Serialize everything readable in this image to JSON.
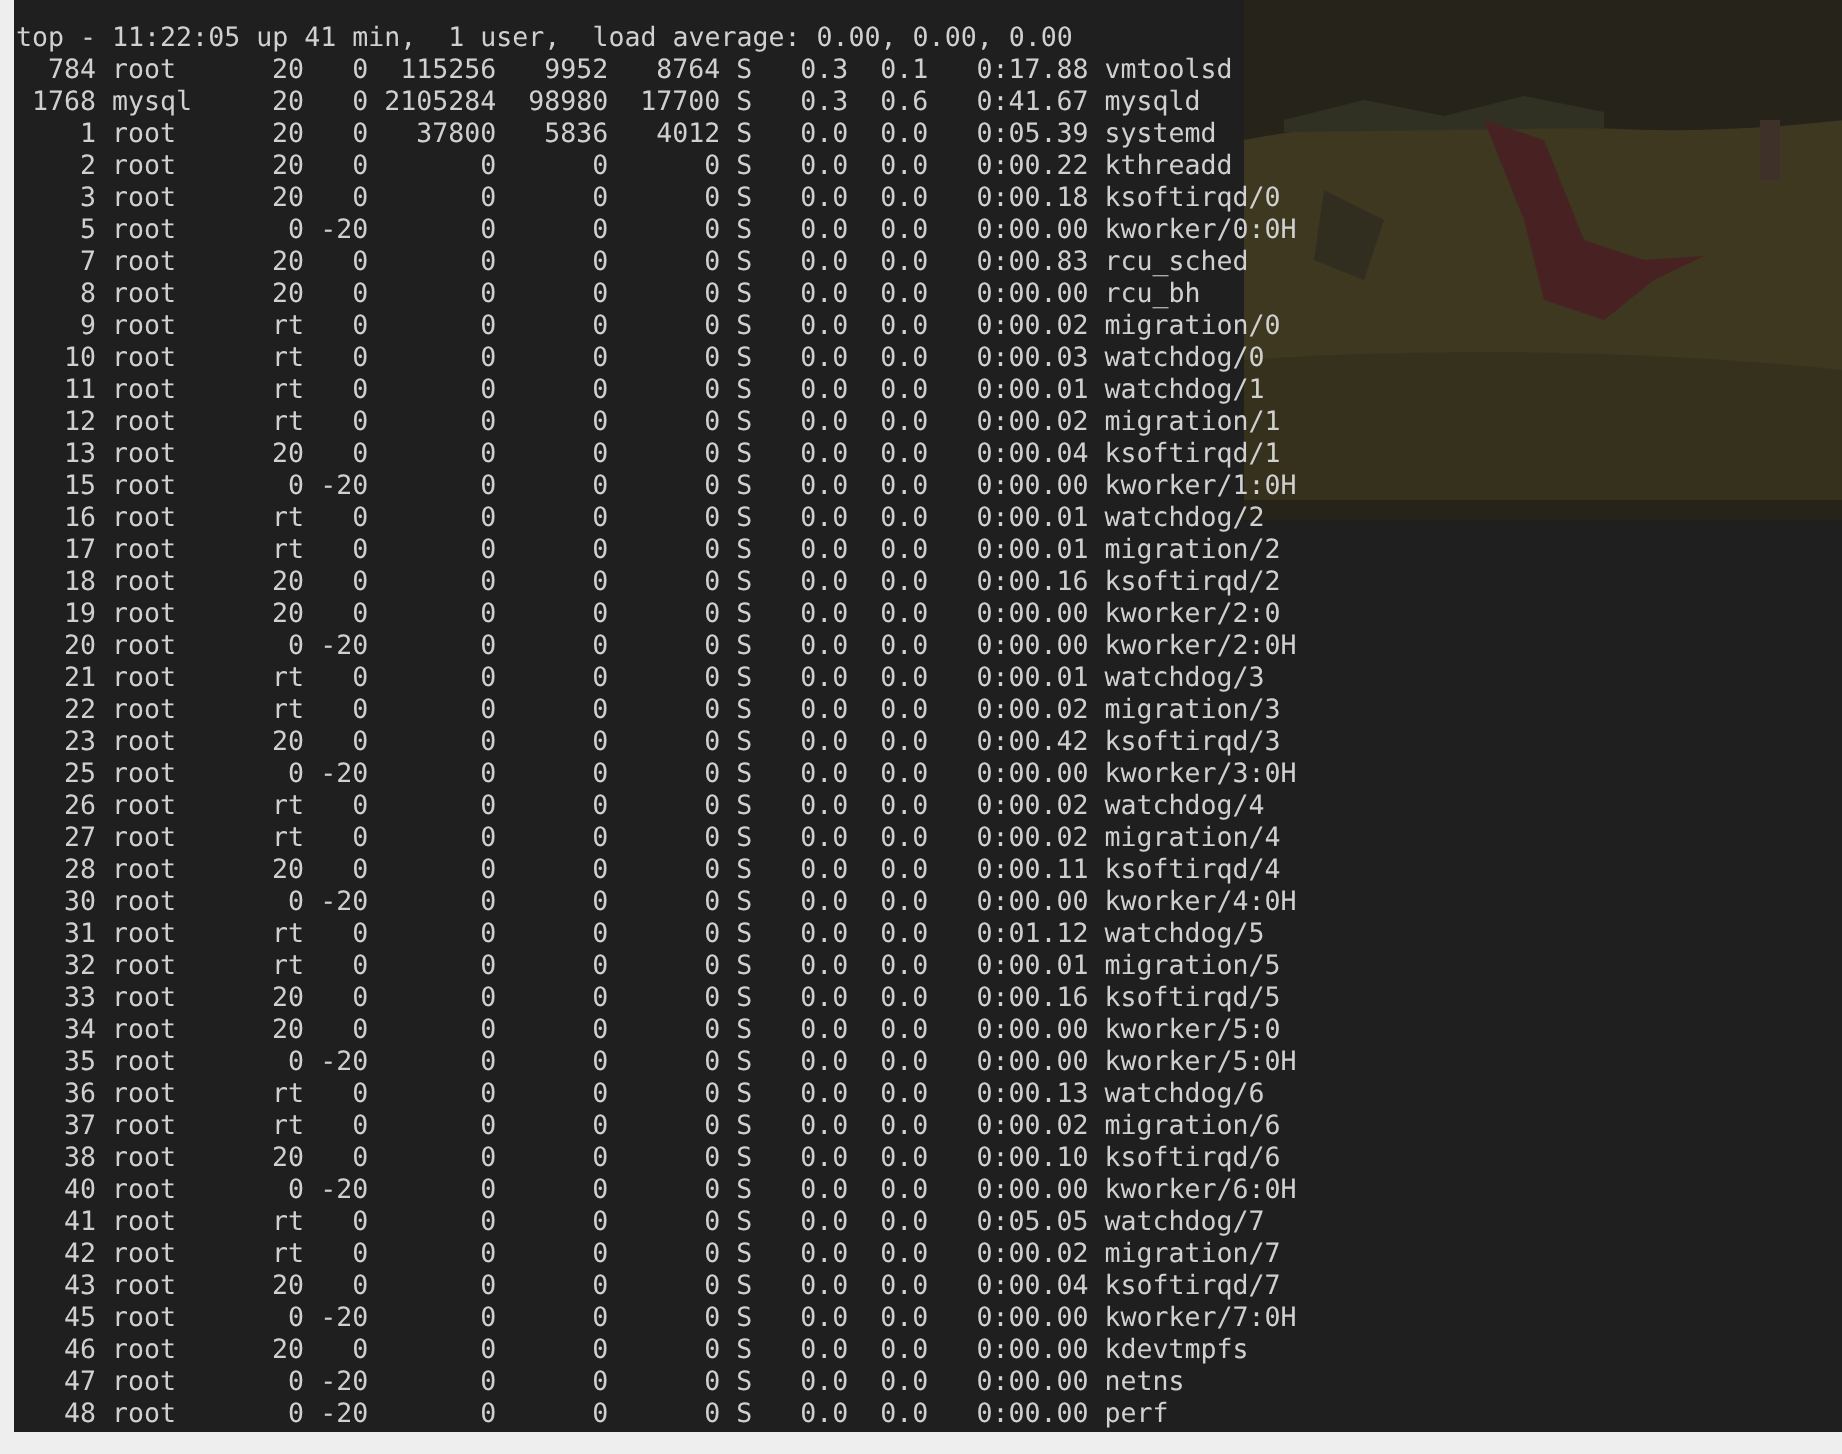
{
  "terminal": {
    "summary": "top - 11:22:05 up 41 min,  1 user,  load average: 0.00, 0.00, 0.00",
    "processes": [
      {
        "pid": "784",
        "user": "root",
        "pr": "20",
        "ni": "0",
        "virt": "115256",
        "res": "9952",
        "shr": "8764",
        "s": "S",
        "cpu": "0.3",
        "mem": "0.1",
        "time": "0:17.88",
        "command": "vmtoolsd"
      },
      {
        "pid": "1768",
        "user": "mysql",
        "pr": "20",
        "ni": "0",
        "virt": "2105284",
        "res": "98980",
        "shr": "17700",
        "s": "S",
        "cpu": "0.3",
        "mem": "0.6",
        "time": "0:41.67",
        "command": "mysqld"
      },
      {
        "pid": "1",
        "user": "root",
        "pr": "20",
        "ni": "0",
        "virt": "37800",
        "res": "5836",
        "shr": "4012",
        "s": "S",
        "cpu": "0.0",
        "mem": "0.0",
        "time": "0:05.39",
        "command": "systemd"
      },
      {
        "pid": "2",
        "user": "root",
        "pr": "20",
        "ni": "0",
        "virt": "0",
        "res": "0",
        "shr": "0",
        "s": "S",
        "cpu": "0.0",
        "mem": "0.0",
        "time": "0:00.22",
        "command": "kthreadd"
      },
      {
        "pid": "3",
        "user": "root",
        "pr": "20",
        "ni": "0",
        "virt": "0",
        "res": "0",
        "shr": "0",
        "s": "S",
        "cpu": "0.0",
        "mem": "0.0",
        "time": "0:00.18",
        "command": "ksoftirqd/0"
      },
      {
        "pid": "5",
        "user": "root",
        "pr": "0",
        "ni": "-20",
        "virt": "0",
        "res": "0",
        "shr": "0",
        "s": "S",
        "cpu": "0.0",
        "mem": "0.0",
        "time": "0:00.00",
        "command": "kworker/0:0H"
      },
      {
        "pid": "7",
        "user": "root",
        "pr": "20",
        "ni": "0",
        "virt": "0",
        "res": "0",
        "shr": "0",
        "s": "S",
        "cpu": "0.0",
        "mem": "0.0",
        "time": "0:00.83",
        "command": "rcu_sched"
      },
      {
        "pid": "8",
        "user": "root",
        "pr": "20",
        "ni": "0",
        "virt": "0",
        "res": "0",
        "shr": "0",
        "s": "S",
        "cpu": "0.0",
        "mem": "0.0",
        "time": "0:00.00",
        "command": "rcu_bh"
      },
      {
        "pid": "9",
        "user": "root",
        "pr": "rt",
        "ni": "0",
        "virt": "0",
        "res": "0",
        "shr": "0",
        "s": "S",
        "cpu": "0.0",
        "mem": "0.0",
        "time": "0:00.02",
        "command": "migration/0"
      },
      {
        "pid": "10",
        "user": "root",
        "pr": "rt",
        "ni": "0",
        "virt": "0",
        "res": "0",
        "shr": "0",
        "s": "S",
        "cpu": "0.0",
        "mem": "0.0",
        "time": "0:00.03",
        "command": "watchdog/0"
      },
      {
        "pid": "11",
        "user": "root",
        "pr": "rt",
        "ni": "0",
        "virt": "0",
        "res": "0",
        "shr": "0",
        "s": "S",
        "cpu": "0.0",
        "mem": "0.0",
        "time": "0:00.01",
        "command": "watchdog/1"
      },
      {
        "pid": "12",
        "user": "root",
        "pr": "rt",
        "ni": "0",
        "virt": "0",
        "res": "0",
        "shr": "0",
        "s": "S",
        "cpu": "0.0",
        "mem": "0.0",
        "time": "0:00.02",
        "command": "migration/1"
      },
      {
        "pid": "13",
        "user": "root",
        "pr": "20",
        "ni": "0",
        "virt": "0",
        "res": "0",
        "shr": "0",
        "s": "S",
        "cpu": "0.0",
        "mem": "0.0",
        "time": "0:00.04",
        "command": "ksoftirqd/1"
      },
      {
        "pid": "15",
        "user": "root",
        "pr": "0",
        "ni": "-20",
        "virt": "0",
        "res": "0",
        "shr": "0",
        "s": "S",
        "cpu": "0.0",
        "mem": "0.0",
        "time": "0:00.00",
        "command": "kworker/1:0H"
      },
      {
        "pid": "16",
        "user": "root",
        "pr": "rt",
        "ni": "0",
        "virt": "0",
        "res": "0",
        "shr": "0",
        "s": "S",
        "cpu": "0.0",
        "mem": "0.0",
        "time": "0:00.01",
        "command": "watchdog/2"
      },
      {
        "pid": "17",
        "user": "root",
        "pr": "rt",
        "ni": "0",
        "virt": "0",
        "res": "0",
        "shr": "0",
        "s": "S",
        "cpu": "0.0",
        "mem": "0.0",
        "time": "0:00.01",
        "command": "migration/2"
      },
      {
        "pid": "18",
        "user": "root",
        "pr": "20",
        "ni": "0",
        "virt": "0",
        "res": "0",
        "shr": "0",
        "s": "S",
        "cpu": "0.0",
        "mem": "0.0",
        "time": "0:00.16",
        "command": "ksoftirqd/2"
      },
      {
        "pid": "19",
        "user": "root",
        "pr": "20",
        "ni": "0",
        "virt": "0",
        "res": "0",
        "shr": "0",
        "s": "S",
        "cpu": "0.0",
        "mem": "0.0",
        "time": "0:00.00",
        "command": "kworker/2:0"
      },
      {
        "pid": "20",
        "user": "root",
        "pr": "0",
        "ni": "-20",
        "virt": "0",
        "res": "0",
        "shr": "0",
        "s": "S",
        "cpu": "0.0",
        "mem": "0.0",
        "time": "0:00.00",
        "command": "kworker/2:0H"
      },
      {
        "pid": "21",
        "user": "root",
        "pr": "rt",
        "ni": "0",
        "virt": "0",
        "res": "0",
        "shr": "0",
        "s": "S",
        "cpu": "0.0",
        "mem": "0.0",
        "time": "0:00.01",
        "command": "watchdog/3"
      },
      {
        "pid": "22",
        "user": "root",
        "pr": "rt",
        "ni": "0",
        "virt": "0",
        "res": "0",
        "shr": "0",
        "s": "S",
        "cpu": "0.0",
        "mem": "0.0",
        "time": "0:00.02",
        "command": "migration/3"
      },
      {
        "pid": "23",
        "user": "root",
        "pr": "20",
        "ni": "0",
        "virt": "0",
        "res": "0",
        "shr": "0",
        "s": "S",
        "cpu": "0.0",
        "mem": "0.0",
        "time": "0:00.42",
        "command": "ksoftirqd/3"
      },
      {
        "pid": "25",
        "user": "root",
        "pr": "0",
        "ni": "-20",
        "virt": "0",
        "res": "0",
        "shr": "0",
        "s": "S",
        "cpu": "0.0",
        "mem": "0.0",
        "time": "0:00.00",
        "command": "kworker/3:0H"
      },
      {
        "pid": "26",
        "user": "root",
        "pr": "rt",
        "ni": "0",
        "virt": "0",
        "res": "0",
        "shr": "0",
        "s": "S",
        "cpu": "0.0",
        "mem": "0.0",
        "time": "0:00.02",
        "command": "watchdog/4"
      },
      {
        "pid": "27",
        "user": "root",
        "pr": "rt",
        "ni": "0",
        "virt": "0",
        "res": "0",
        "shr": "0",
        "s": "S",
        "cpu": "0.0",
        "mem": "0.0",
        "time": "0:00.02",
        "command": "migration/4"
      },
      {
        "pid": "28",
        "user": "root",
        "pr": "20",
        "ni": "0",
        "virt": "0",
        "res": "0",
        "shr": "0",
        "s": "S",
        "cpu": "0.0",
        "mem": "0.0",
        "time": "0:00.11",
        "command": "ksoftirqd/4"
      },
      {
        "pid": "30",
        "user": "root",
        "pr": "0",
        "ni": "-20",
        "virt": "0",
        "res": "0",
        "shr": "0",
        "s": "S",
        "cpu": "0.0",
        "mem": "0.0",
        "time": "0:00.00",
        "command": "kworker/4:0H"
      },
      {
        "pid": "31",
        "user": "root",
        "pr": "rt",
        "ni": "0",
        "virt": "0",
        "res": "0",
        "shr": "0",
        "s": "S",
        "cpu": "0.0",
        "mem": "0.0",
        "time": "0:01.12",
        "command": "watchdog/5"
      },
      {
        "pid": "32",
        "user": "root",
        "pr": "rt",
        "ni": "0",
        "virt": "0",
        "res": "0",
        "shr": "0",
        "s": "S",
        "cpu": "0.0",
        "mem": "0.0",
        "time": "0:00.01",
        "command": "migration/5"
      },
      {
        "pid": "33",
        "user": "root",
        "pr": "20",
        "ni": "0",
        "virt": "0",
        "res": "0",
        "shr": "0",
        "s": "S",
        "cpu": "0.0",
        "mem": "0.0",
        "time": "0:00.16",
        "command": "ksoftirqd/5"
      },
      {
        "pid": "34",
        "user": "root",
        "pr": "20",
        "ni": "0",
        "virt": "0",
        "res": "0",
        "shr": "0",
        "s": "S",
        "cpu": "0.0",
        "mem": "0.0",
        "time": "0:00.00",
        "command": "kworker/5:0"
      },
      {
        "pid": "35",
        "user": "root",
        "pr": "0",
        "ni": "-20",
        "virt": "0",
        "res": "0",
        "shr": "0",
        "s": "S",
        "cpu": "0.0",
        "mem": "0.0",
        "time": "0:00.00",
        "command": "kworker/5:0H"
      },
      {
        "pid": "36",
        "user": "root",
        "pr": "rt",
        "ni": "0",
        "virt": "0",
        "res": "0",
        "shr": "0",
        "s": "S",
        "cpu": "0.0",
        "mem": "0.0",
        "time": "0:00.13",
        "command": "watchdog/6"
      },
      {
        "pid": "37",
        "user": "root",
        "pr": "rt",
        "ni": "0",
        "virt": "0",
        "res": "0",
        "shr": "0",
        "s": "S",
        "cpu": "0.0",
        "mem": "0.0",
        "time": "0:00.02",
        "command": "migration/6"
      },
      {
        "pid": "38",
        "user": "root",
        "pr": "20",
        "ni": "0",
        "virt": "0",
        "res": "0",
        "shr": "0",
        "s": "S",
        "cpu": "0.0",
        "mem": "0.0",
        "time": "0:00.10",
        "command": "ksoftirqd/6"
      },
      {
        "pid": "40",
        "user": "root",
        "pr": "0",
        "ni": "-20",
        "virt": "0",
        "res": "0",
        "shr": "0",
        "s": "S",
        "cpu": "0.0",
        "mem": "0.0",
        "time": "0:00.00",
        "command": "kworker/6:0H"
      },
      {
        "pid": "41",
        "user": "root",
        "pr": "rt",
        "ni": "0",
        "virt": "0",
        "res": "0",
        "shr": "0",
        "s": "S",
        "cpu": "0.0",
        "mem": "0.0",
        "time": "0:05.05",
        "command": "watchdog/7"
      },
      {
        "pid": "42",
        "user": "root",
        "pr": "rt",
        "ni": "0",
        "virt": "0",
        "res": "0",
        "shr": "0",
        "s": "S",
        "cpu": "0.0",
        "mem": "0.0",
        "time": "0:00.02",
        "command": "migration/7"
      },
      {
        "pid": "43",
        "user": "root",
        "pr": "20",
        "ni": "0",
        "virt": "0",
        "res": "0",
        "shr": "0",
        "s": "S",
        "cpu": "0.0",
        "mem": "0.0",
        "time": "0:00.04",
        "command": "ksoftirqd/7"
      },
      {
        "pid": "45",
        "user": "root",
        "pr": "0",
        "ni": "-20",
        "virt": "0",
        "res": "0",
        "shr": "0",
        "s": "S",
        "cpu": "0.0",
        "mem": "0.0",
        "time": "0:00.00",
        "command": "kworker/7:0H"
      },
      {
        "pid": "46",
        "user": "root",
        "pr": "20",
        "ni": "0",
        "virt": "0",
        "res": "0",
        "shr": "0",
        "s": "S",
        "cpu": "0.0",
        "mem": "0.0",
        "time": "0:00.00",
        "command": "kdevtmpfs"
      },
      {
        "pid": "47",
        "user": "root",
        "pr": "0",
        "ni": "-20",
        "virt": "0",
        "res": "0",
        "shr": "0",
        "s": "S",
        "cpu": "0.0",
        "mem": "0.0",
        "time": "0:00.00",
        "command": "netns"
      },
      {
        "pid": "48",
        "user": "root",
        "pr": "0",
        "ni": "-20",
        "virt": "0",
        "res": "0",
        "shr": "0",
        "s": "S",
        "cpu": "0.0",
        "mem": "0.0",
        "time": "0:00.00",
        "command": "perf"
      }
    ]
  }
}
